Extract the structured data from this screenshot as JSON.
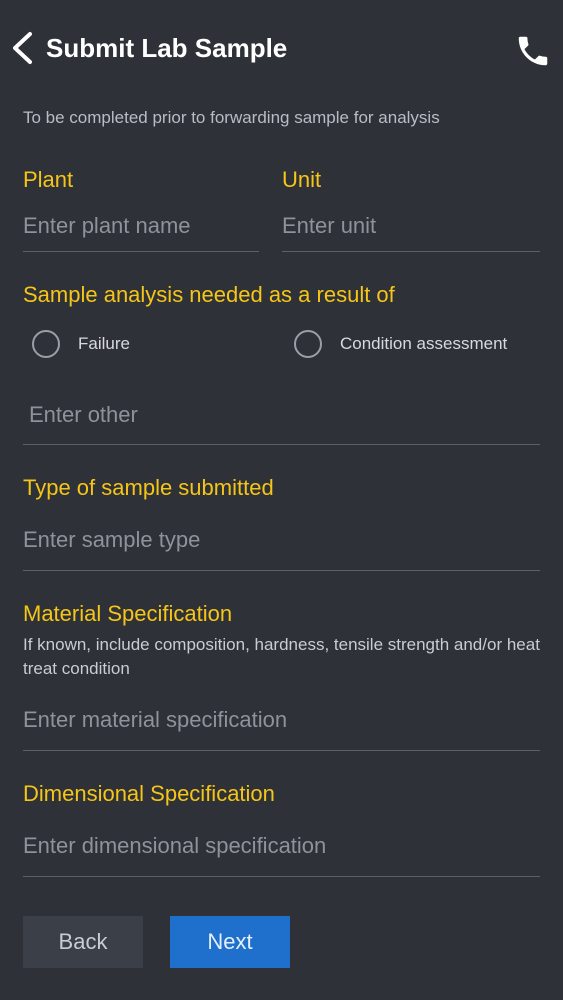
{
  "header": {
    "title": "Submit Lab Sample",
    "back_icon": "chevron-left-icon",
    "call_icon": "phone-icon"
  },
  "subtitle": "To be completed prior to forwarding sample for analysis",
  "plant": {
    "label": "Plant",
    "placeholder": "Enter plant name",
    "value": ""
  },
  "unit": {
    "label": "Unit",
    "placeholder": "Enter unit",
    "value": ""
  },
  "analysis": {
    "label": "Sample analysis needed as a result of",
    "options": [
      {
        "label": "Failure",
        "selected": false
      },
      {
        "label": "Condition assessment",
        "selected": false
      }
    ],
    "other_placeholder": "Enter other"
  },
  "sample_type": {
    "label": "Type of sample submitted",
    "placeholder": "Enter sample type"
  },
  "material": {
    "label": "Material Specification",
    "helper": "If known, include composition, hardness, tensile strength and/or heat treat condition",
    "placeholder": "Enter material specification"
  },
  "dimensional": {
    "label": "Dimensional Specification",
    "placeholder": "Enter dimensional specification"
  },
  "buttons": {
    "back": "Back",
    "next": "Next"
  },
  "colors": {
    "background": "#2e3137",
    "accent_label": "#f5c518",
    "primary_button": "#1f6fcc",
    "secondary_button": "#3b3f47"
  }
}
